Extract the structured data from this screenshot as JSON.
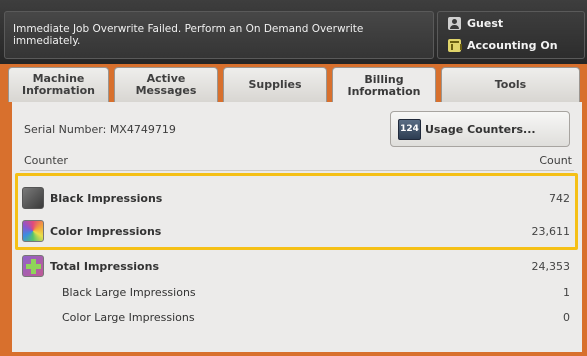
{
  "status": {
    "message": "Immediate Job Overwrite Failed.  Perform an On Demand Overwrite immediately."
  },
  "user_panel": {
    "user_label": "Guest",
    "user_icon": "guest-user-icon",
    "accounting_label": "Accounting On",
    "accounting_icon": "accounting-icon"
  },
  "tabs": [
    {
      "label": "Machine Information"
    },
    {
      "label": "Active Messages"
    },
    {
      "label": "Supplies"
    },
    {
      "label": "Billing Information",
      "active": true
    },
    {
      "label": "Tools"
    }
  ],
  "billing": {
    "serial_number": "Serial Number: MX4749719",
    "usage_counters_label": "Usage Counters...",
    "usage_counters_icon_text": "124",
    "counter_header": "Counter",
    "count_header": "Count",
    "counters": [
      {
        "label": "Black Impressions",
        "value": "742",
        "icon": "black-impressions-icon"
      },
      {
        "label": "Color Impressions",
        "value": "23,611",
        "icon": "color-impressions-icon"
      },
      {
        "label": "Total Impressions",
        "value": "24,353",
        "icon": "total-impressions-icon"
      },
      {
        "label": "Black Large Impressions",
        "value": "1"
      },
      {
        "label": "Color Large Impressions",
        "value": "0"
      }
    ]
  },
  "colors": {
    "frame_orange": "#d8702d",
    "highlight_yellow": "#f5c016"
  }
}
